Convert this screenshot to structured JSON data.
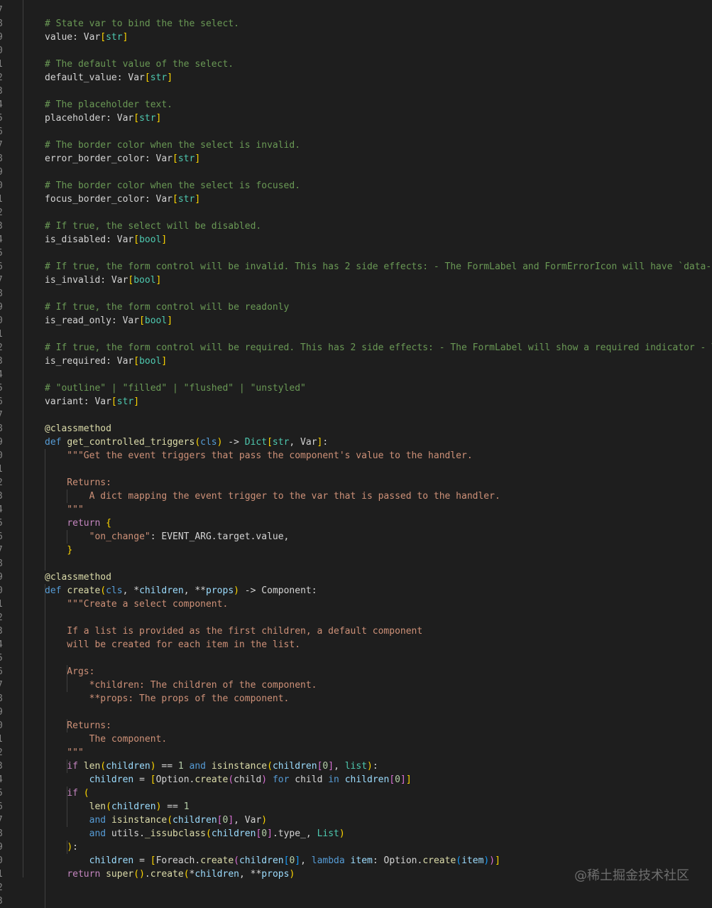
{
  "line_numbers": [
    "7",
    "8",
    "9",
    "0",
    "1",
    "2",
    "3",
    "4",
    "5",
    "6",
    "7",
    "8",
    "9",
    "0",
    "1",
    "2",
    "3",
    "4",
    "5",
    "6",
    "7",
    "8",
    "9",
    "0",
    "1",
    "2",
    "3",
    "4",
    "5",
    "6",
    "7",
    "8",
    "9",
    "0",
    "1",
    "2",
    "3",
    "4",
    "5",
    "6",
    "7",
    "8",
    "9",
    "0",
    "1",
    "2",
    "3",
    "4",
    "5",
    "6",
    "7",
    "8",
    "9",
    "0",
    "1",
    "2",
    "3",
    "4",
    "5",
    "6",
    "7",
    "8",
    "9",
    "0",
    "1",
    "2",
    "3"
  ],
  "code_lines": [
    "",
    "# State var to bind the the select.",
    "value: Var[str]",
    "",
    "# The default value of the select.",
    "default_value: Var[str]",
    "",
    "# The placeholder text.",
    "placeholder: Var[str]",
    "",
    "# The border color when the select is invalid.",
    "error_border_color: Var[str]",
    "",
    "# The border color when the select is focused.",
    "focus_border_color: Var[str]",
    "",
    "# If true, the select will be disabled.",
    "is_disabled: Var[bool]",
    "",
    "# If true, the form control will be invalid. This has 2 side effects: - The FormLabel and FormErrorIcon will have `data-in",
    "is_invalid: Var[bool]",
    "",
    "# If true, the form control will be readonly",
    "is_read_only: Var[bool]",
    "",
    "# If true, the form control will be required. This has 2 side effects: - The FormLabel will show a required indicator - Th",
    "is_required: Var[bool]",
    "",
    "# \"outline\" | \"filled\" | \"flushed\" | \"unstyled\"",
    "variant: Var[str]",
    "",
    "@classmethod",
    "def get_controlled_triggers(cls) -> Dict[str, Var]:",
    "    \"\"\"Get the event triggers that pass the component's value to the handler.",
    "",
    "    Returns:",
    "        A dict mapping the event trigger to the var that is passed to the handler.",
    "    \"\"\"",
    "    return {",
    "        \"on_change\": EVENT_ARG.target.value,",
    "    }",
    "",
    "@classmethod",
    "def create(cls, *children, **props) -> Component:",
    "    \"\"\"Create a select component.",
    "",
    "    If a list is provided as the first children, a default component",
    "    will be created for each item in the list.",
    "",
    "    Args:",
    "        *children: The children of the component.",
    "        **props: The props of the component.",
    "",
    "    Returns:",
    "        The component.",
    "    \"\"\"",
    "    if len(children) == 1 and isinstance(children[0], list):",
    "        children = [Option.create(child) for child in children[0]]",
    "    if (",
    "        len(children) == 1",
    "        and isinstance(children[0], Var)",
    "        and utils._issubclass(children[0].type_, List)",
    "    ):",
    "        children = [Foreach.create(children[0], lambda item: Option.create(item))]",
    "    return super().create(*children, **props)",
    "",
    ""
  ],
  "watermark": "@稀土掘金技术社区"
}
